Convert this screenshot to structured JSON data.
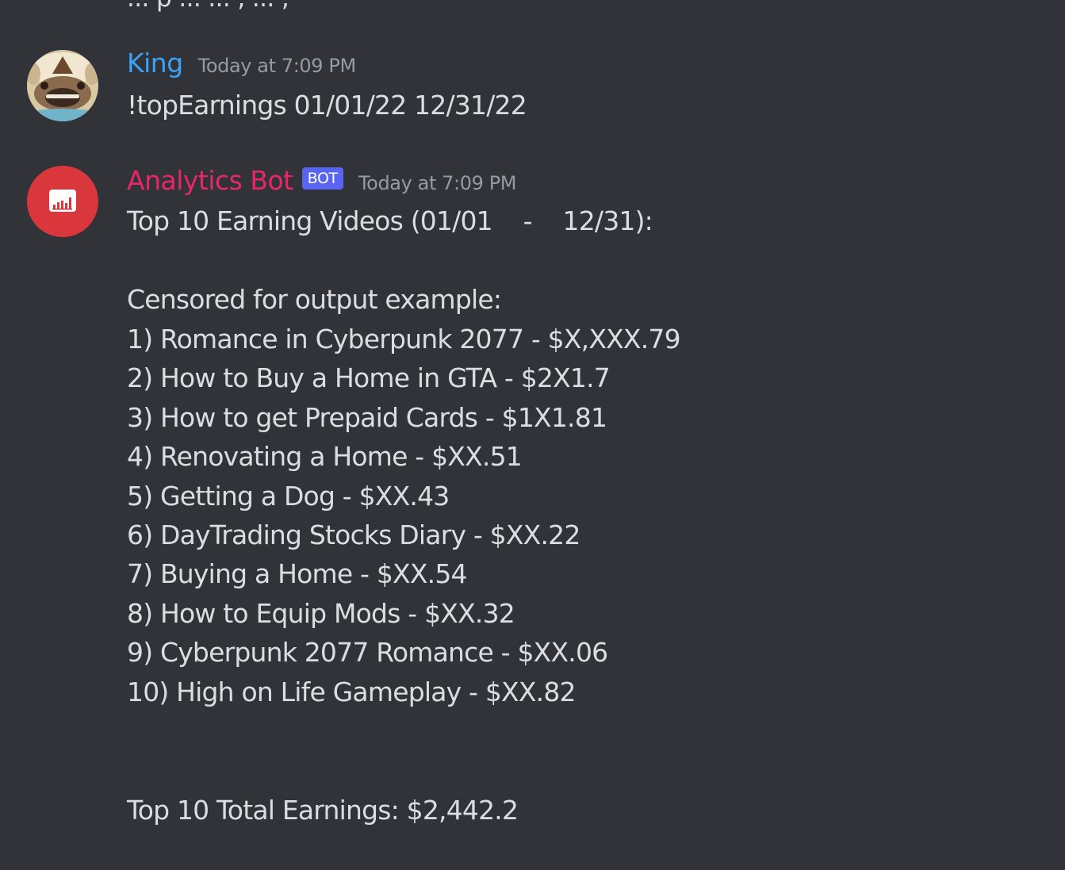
{
  "theme": {
    "background": "#313338",
    "text": "#dbdee1",
    "muted": "#949ba4",
    "bot_tag_bg": "#5865f2",
    "bot_avatar_bg": "#da373c"
  },
  "previous_message": {
    "partial_text": "... p ... ... , ... ,"
  },
  "messages": [
    {
      "author": "King",
      "author_color": "#3ba3f7",
      "timestamp": "Today at 7:09 PM",
      "text": "!topEarnings 01/01/22 12/31/22",
      "avatar_icon": "appa-avatar-icon"
    },
    {
      "author": "Analytics Bot",
      "author_color": "#e8266b",
      "bot_tag": "BOT",
      "timestamp": "Today at 7:09 PM",
      "avatar_icon": "bar-chart-icon",
      "title": "Top 10 Earning Videos (01/01    -    12/31):",
      "subtitle": "Censored for output example:",
      "items": [
        "1) Romance in Cyberpunk 2077 - $X,XXX.79",
        "2) How to Buy a Home in GTA - $2X1.7",
        "3) How to get Prepaid Cards - $1X1.81",
        "4) Renovating a Home - $XX.51",
        "5) Getting a Dog - $XX.43",
        "6) DayTrading Stocks Diary - $XX.22",
        "7) Buying a Home - $XX.54",
        "8) How to Equip Mods - $XX.32",
        "9) Cyberpunk 2077 Romance - $XX.06",
        "10) High on Life Gameplay - $XX.82"
      ],
      "total": "Top 10 Total Earnings: $2,442.2"
    }
  ]
}
